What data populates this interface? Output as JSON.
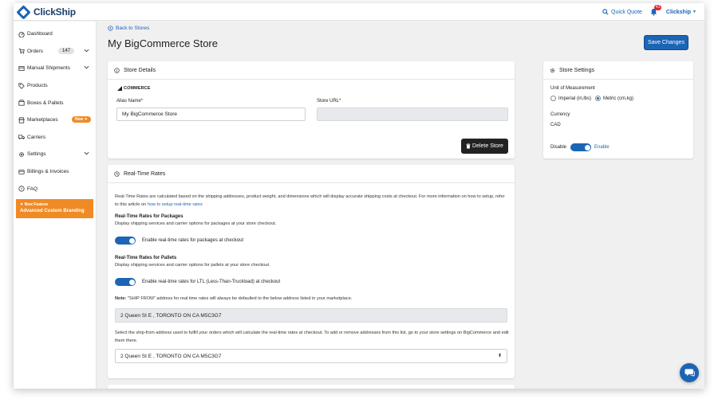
{
  "app": {
    "brand": "ClickShip",
    "quick_quote": "Quick Quote",
    "notification_count": "43",
    "user_menu": "Clickship"
  },
  "sidebar": {
    "items": [
      {
        "label": "Dashboard",
        "icon": "dashboard-icon"
      },
      {
        "label": "Orders",
        "icon": "cart-icon",
        "count": "147"
      },
      {
        "label": "Manual Shipments",
        "icon": "shipment-icon"
      },
      {
        "label": "Products",
        "icon": "tag-icon"
      },
      {
        "label": "Boxes & Pallets",
        "icon": "box-icon"
      },
      {
        "label": "Marketplaces",
        "icon": "store-icon",
        "badge": "New"
      },
      {
        "label": "Carriers",
        "icon": "truck-icon"
      },
      {
        "label": "Settings",
        "icon": "gear-icon"
      },
      {
        "label": "Billings & Invoices",
        "icon": "invoice-icon"
      },
      {
        "label": "FAQ",
        "icon": "question-icon"
      }
    ],
    "promo_small": "New Feature",
    "promo_title": "Advanced Custom Branding"
  },
  "main": {
    "back_link": "Back to Stores",
    "title": "My BigCommerce Store",
    "save_button": "Save Changes"
  },
  "store_details": {
    "header": "Store Details",
    "logo_text": "COMMERCE",
    "alias_label": "Alias Name*",
    "alias_value": "My BigCommerce Store",
    "url_label": "Store URL*",
    "url_value": "",
    "delete_button": "Delete Store"
  },
  "store_settings": {
    "header": "Store Settings",
    "unit_label": "Unit of Measurement",
    "unit_imperial": "Imperial (in,lbs)",
    "unit_metric": "Metric (cm,kg)",
    "currency_label": "Currency",
    "currency_value": "CAD",
    "disable_label": "Disable",
    "enable_label": "Enable"
  },
  "rates": {
    "header": "Real-Time Rates",
    "intro_a": "Real-Time Rates are calculated based on the shipping addresses, product weight, and dimensions which will display accurate shipping costs at checkout. For more information on how to setup, refer to this article on ",
    "intro_link": "how to setup real-time rates",
    "packages_title": "Real-Time Rates for Packages",
    "packages_desc": "Display shipping services and carrier options for packages at your store checkout.",
    "packages_toggle": "Enable real-time rates for packages at checkout",
    "pallets_title": "Real-Time Rates for Pallets",
    "pallets_desc": "Display shipping services and carrier options for pallets at your store checkout.",
    "pallets_toggle": "Enable real-time rates for LTL (Less-Than-Truckload) at checkout",
    "note_bold": "Note:",
    "note_text": " \"SHIP FROM\" address for real time rates will always be defaulted to the below address listed in your marketplace.",
    "address_value": "2 Queen St E , TORONTO ON CA M5C3G7",
    "select_desc": "Select the ship-from address used to fulfill your orders which will calculate the real-time rates at checkout. To add or remove addresses from this list, go to your store settings on BigCommerce and edit them there.",
    "select_value": "2 Queen St E , TORONTO ON CA M5C3G7"
  },
  "colors": {
    "accent": "#1c64b4",
    "promo": "#f08a24",
    "danger_badge": "#d9262c"
  }
}
